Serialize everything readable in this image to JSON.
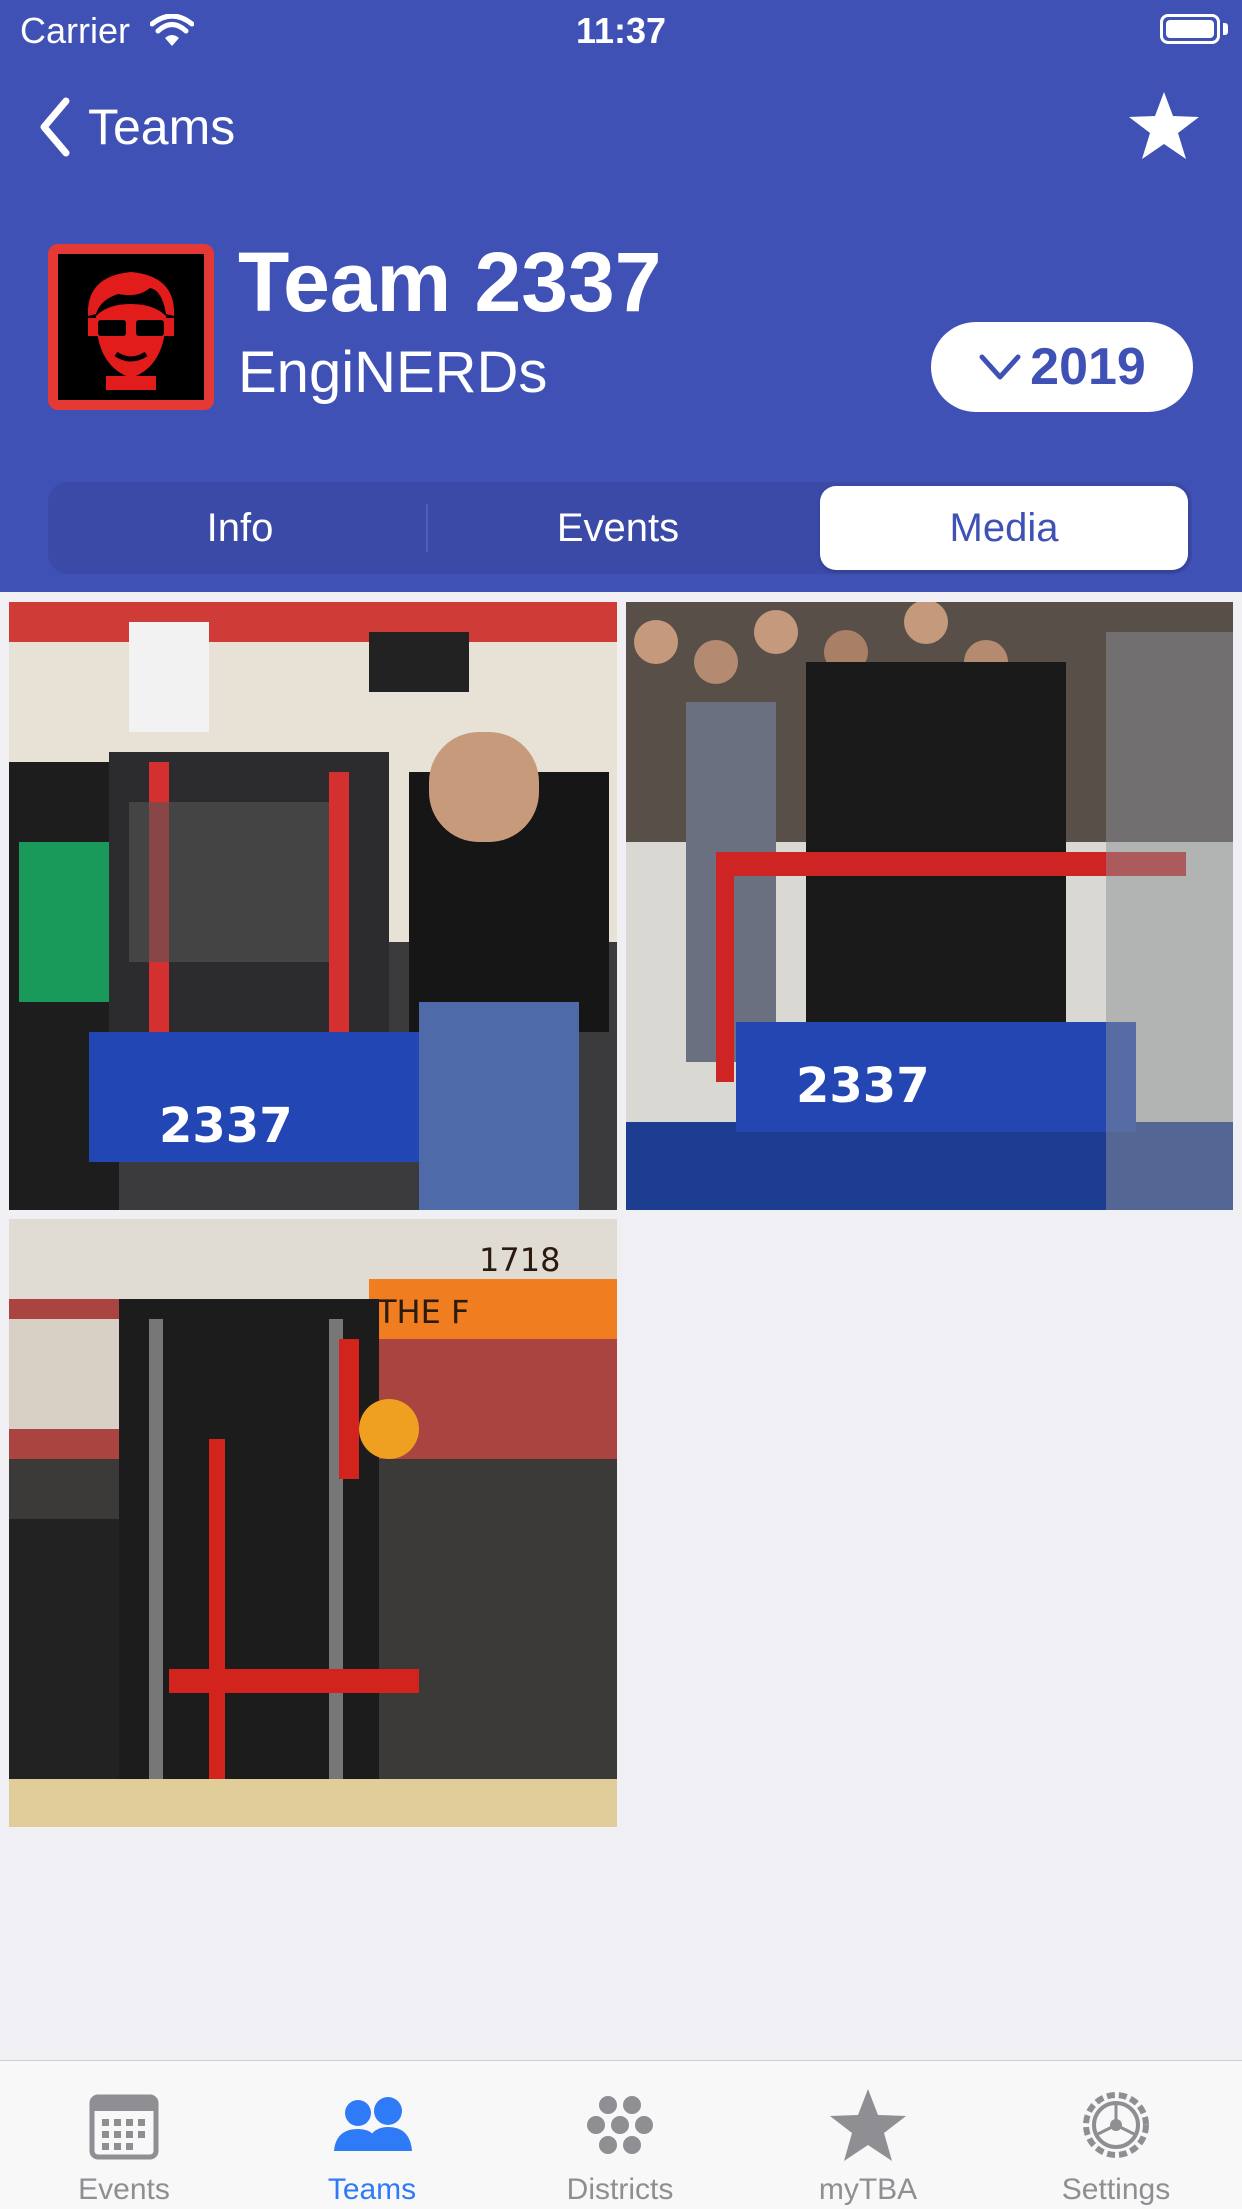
{
  "status_bar": {
    "carrier": "Carrier",
    "time": "11:37"
  },
  "nav": {
    "back_label": "Teams",
    "star_icon": "star-icon"
  },
  "team": {
    "title": "Team 2337",
    "nickname": "EngiNERDs",
    "year": "2019",
    "avatar_icon": "team-avatar-face"
  },
  "segments": {
    "items": [
      "Info",
      "Events",
      "Media"
    ],
    "selected": "Media"
  },
  "media": {
    "photos": [
      {
        "robot_number": "2337"
      },
      {
        "robot_number": "2337"
      },
      {
        "robot_number": "1718",
        "banner": "THE F"
      }
    ]
  },
  "tabbar": {
    "items": [
      {
        "label": "Events",
        "icon": "calendar-icon"
      },
      {
        "label": "Teams",
        "icon": "people-icon"
      },
      {
        "label": "Districts",
        "icon": "dots-icon"
      },
      {
        "label": "myTBA",
        "icon": "star-icon"
      },
      {
        "label": "Settings",
        "icon": "gear-icon"
      }
    ],
    "selected": "Teams"
  },
  "colors": {
    "brand": "#3f51b5",
    "accent_tab": "#2f7af7",
    "avatar_border": "#e53935"
  }
}
